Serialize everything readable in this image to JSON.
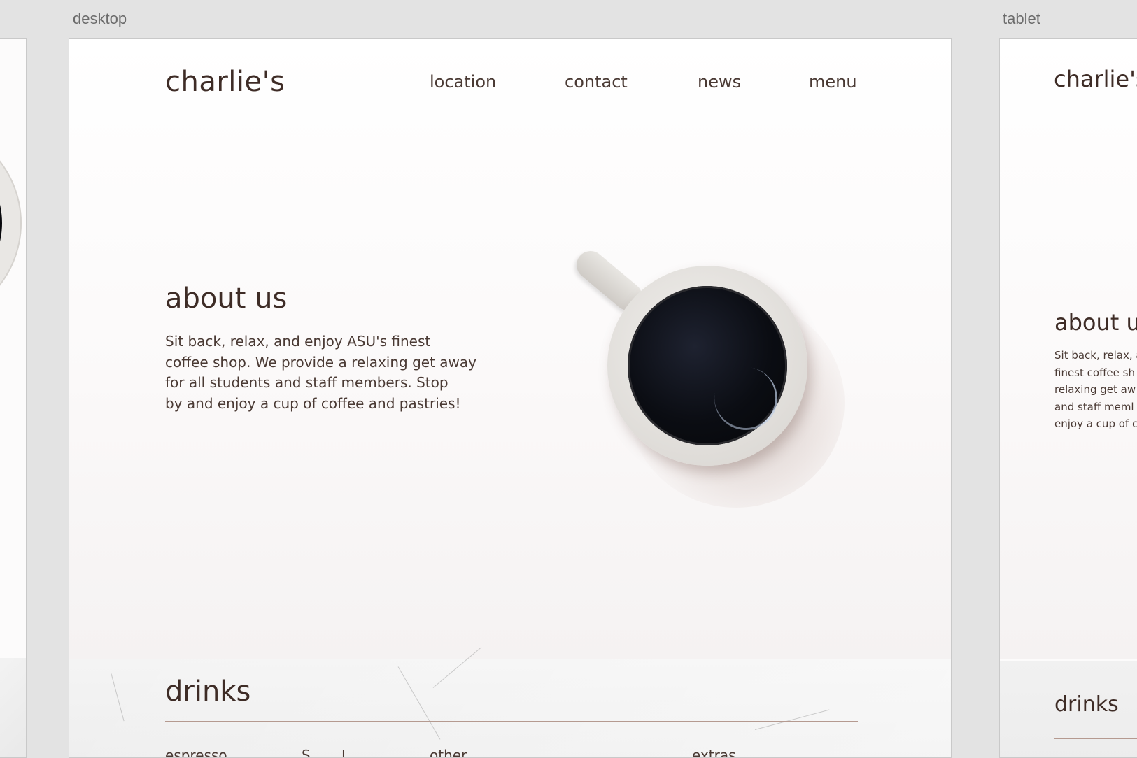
{
  "artboards": {
    "desktop_label": "desktop",
    "tablet_label": "tablet"
  },
  "desktop": {
    "brand": "charlie's",
    "nav": [
      "location",
      "contact",
      "news",
      "menu"
    ],
    "about": {
      "title": "about us",
      "lines": [
        "Sit back, relax, and enjoy ASU's finest",
        "coffee shop. We provide a relaxing get away",
        "for all students and staff members. Stop",
        "by and enjoy a cup of coffee and pastries!"
      ]
    },
    "drinks": {
      "title": "drinks",
      "columns": [
        "espresso",
        "S",
        "L",
        "other",
        "extras"
      ]
    }
  },
  "tablet": {
    "brand": "charlie's",
    "about": {
      "title": "about u",
      "lines": [
        "Sit back, relax, a",
        "finest coffee sh",
        "relaxing get aw",
        "and staff meml",
        "enjoy a cup of c"
      ]
    },
    "drinks_title": "drinks"
  },
  "colors": {
    "text_brown": "#3e2c26",
    "rule": "#b59a90",
    "canvas_bg": "#e3e3e3"
  }
}
